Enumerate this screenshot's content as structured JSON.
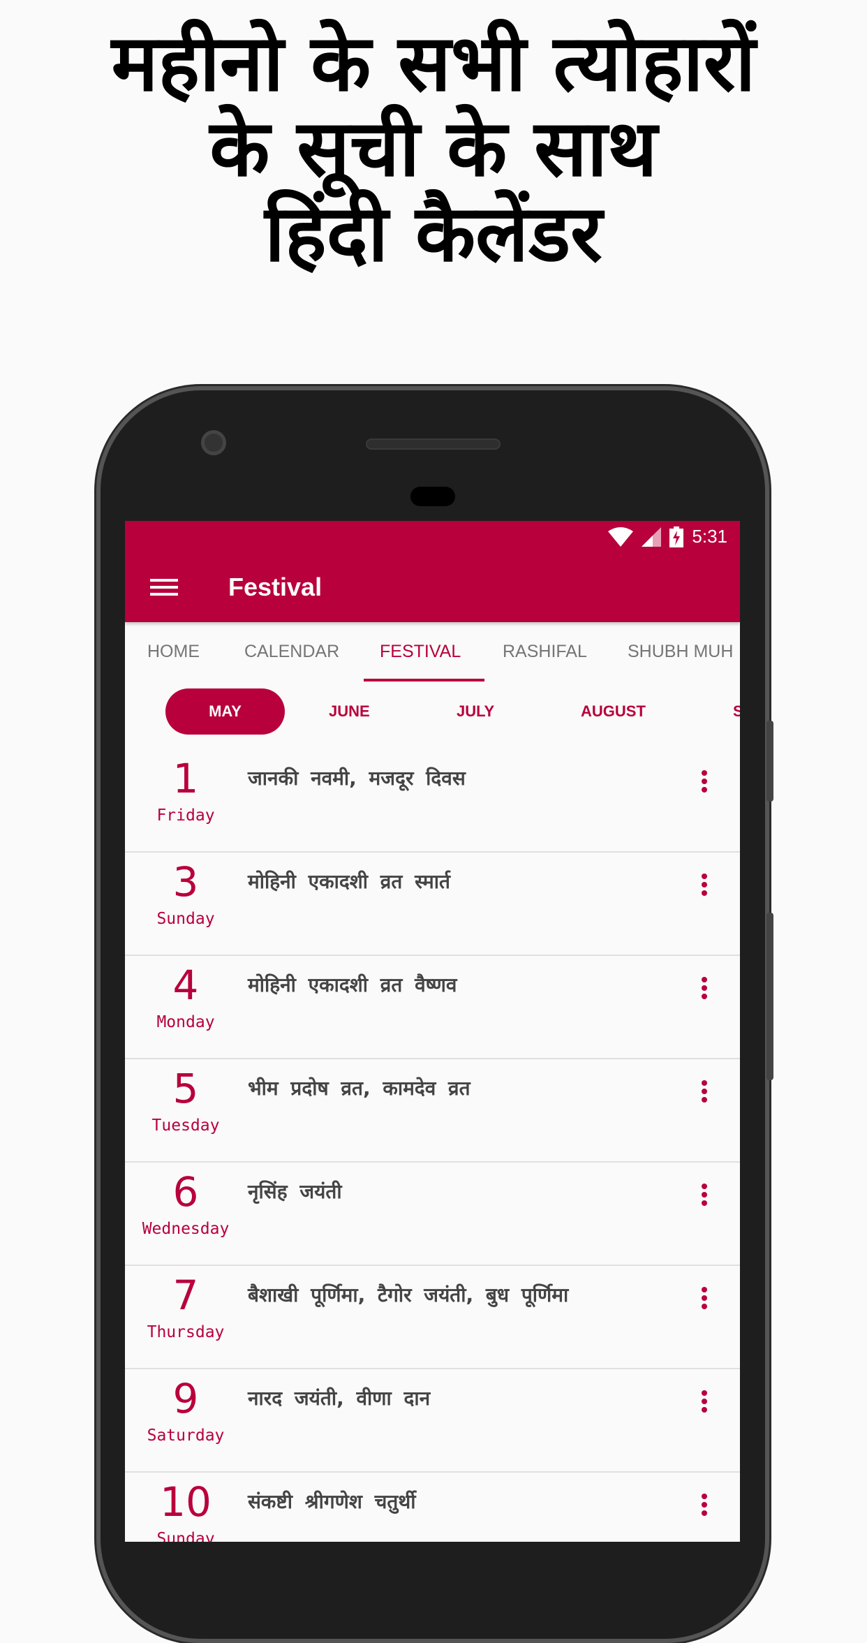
{
  "headline": [
    "महीनो के सभी त्योहारों",
    "के सूची के साथ",
    "हिंदी कैलेंडर"
  ],
  "colors": {
    "brand": "#b8003c",
    "background": "#fafafa"
  },
  "status_bar": {
    "time": "5:31",
    "icons": [
      "wifi-icon",
      "signal-icon",
      "battery-charging-icon"
    ]
  },
  "app_bar": {
    "title": "Festival",
    "menu_icon": "hamburger-menu-icon"
  },
  "tabs": [
    {
      "label": "HOME"
    },
    {
      "label": "CALENDAR"
    },
    {
      "label": "FESTIVAL",
      "active": true
    },
    {
      "label": "RASHIFAL"
    },
    {
      "label": "SHUBH MUH"
    }
  ],
  "months": [
    {
      "label": "MAY",
      "active": true
    },
    {
      "label": "JUNE"
    },
    {
      "label": "JULY"
    },
    {
      "label": "AUGUST"
    },
    {
      "label": "S"
    }
  ],
  "festivals": [
    {
      "date": "1",
      "day": "Friday",
      "name": "जानकी नवमी, मजदूर दिवस"
    },
    {
      "date": "3",
      "day": "Sunday",
      "name": "मोहिनी एकादशी व्रत स्मार्त"
    },
    {
      "date": "4",
      "day": "Monday",
      "name": "मोहिनी एकादशी व्रत वैष्णव"
    },
    {
      "date": "5",
      "day": "Tuesday",
      "name": "भीम प्रदोष व्रत, कामदेव व्रत"
    },
    {
      "date": "6",
      "day": "Wednesday",
      "name": "नृसिंह जयंती"
    },
    {
      "date": "7",
      "day": "Thursday",
      "name": "बैशाखी पूर्णिमा, टैगोर जयंती, बुध पूर्णिमा"
    },
    {
      "date": "9",
      "day": "Saturday",
      "name": "नारद जयंती, वीणा दान"
    },
    {
      "date": "10",
      "day": "Sunday",
      "name": "संकष्टी श्रीगणेश चतुर्थी"
    }
  ]
}
